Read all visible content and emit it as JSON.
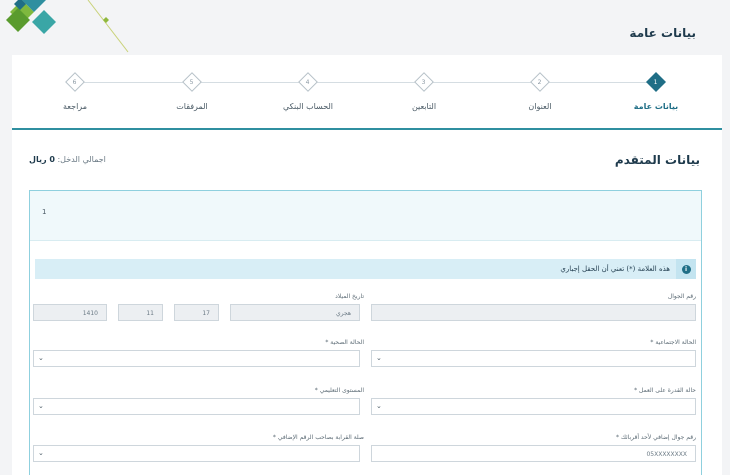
{
  "page": {
    "title": "بيانات عامة"
  },
  "steps": [
    {
      "num": "1",
      "label": "بيانات عامة",
      "active": true
    },
    {
      "num": "2",
      "label": "العنوان",
      "active": false
    },
    {
      "num": "3",
      "label": "التابعين",
      "active": false
    },
    {
      "num": "4",
      "label": "الحساب البنكي",
      "active": false
    },
    {
      "num": "5",
      "label": "المرفقات",
      "active": false
    },
    {
      "num": "6",
      "label": "مراجعة",
      "active": false
    }
  ],
  "applicant": {
    "title": "بيانات المتقدم",
    "income_label": "اجمالي الدخل:",
    "income_value": "0 ريال",
    "box_number": "1",
    "alert_text": "هذه العلامة (*) تعني أن الحقل إجباري"
  },
  "fields": {
    "mobile_label": "رقم الجوال",
    "birth_label": "تاريخ الميلاد",
    "calendar_value": "هجري",
    "birth_day": "17",
    "birth_month": "11",
    "birth_year": "1410",
    "social_status_label": "الحالة الاجتماعية *",
    "health_status_label": "الحالة الصحية *",
    "work_ability_label": "حالة القدرة على العمل *",
    "education_label": "المستوى التعليمي *",
    "alt_mobile_label": "رقم جوال إضافي لأحد أقربائك *",
    "alt_mobile_value": "05XXXXXXXX",
    "relation_label": "صلة القرابة بصاحب الرقم الإضافي *"
  },
  "colors": {
    "primary": "#1f6e86",
    "accent_line": "#2f8fa0",
    "box_border": "#8fd0de",
    "alert_bg": "#d8eef6"
  },
  "icons": {
    "step": "diamond-icon",
    "info": "info-icon",
    "dropdown": "chevron-down-icon"
  }
}
